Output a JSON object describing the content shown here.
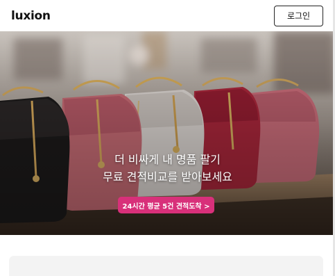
{
  "header": {
    "logo": "luxion",
    "login_label": "로그인"
  },
  "hero": {
    "line1": "더 비싸게 내 명품 팔기",
    "line2": "무료 견적비교를 받아보세요",
    "cta_label": "24시간 평균 5건 견적도착 >"
  },
  "colors": {
    "accent": "#d8307a",
    "text_dark": "#111111"
  }
}
